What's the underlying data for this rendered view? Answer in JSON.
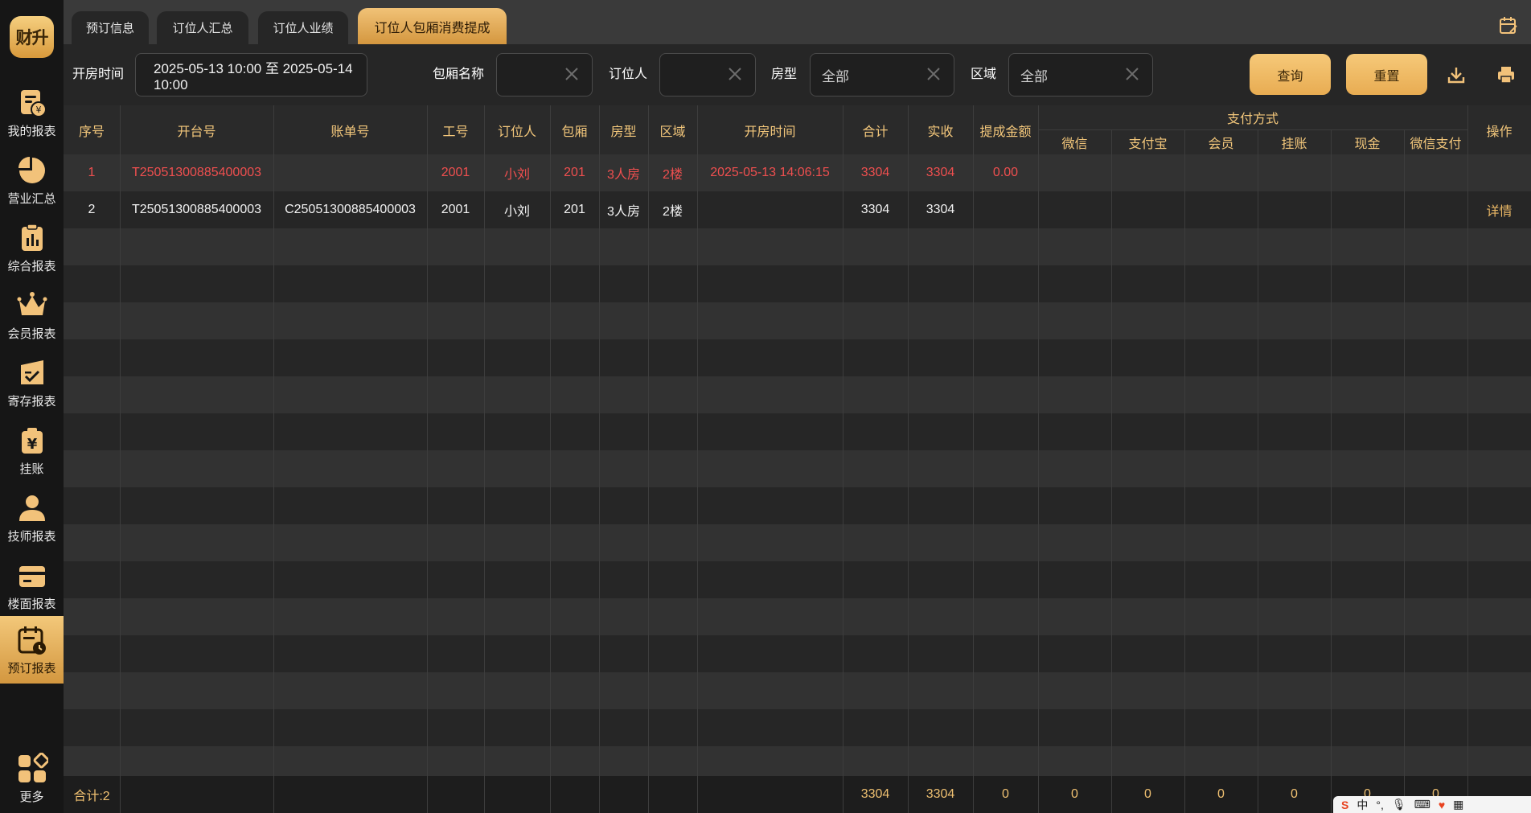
{
  "sidebar": {
    "logo_text": "财升",
    "items": [
      {
        "label": "我的报表",
        "icon": "report-money-icon"
      },
      {
        "label": "营业汇总",
        "icon": "pie-chart-icon"
      },
      {
        "label": "综合报表",
        "icon": "clipboard-chart-icon"
      },
      {
        "label": "会员报表",
        "icon": "crown-icon"
      },
      {
        "label": "寄存报表",
        "icon": "storage-check-icon"
      },
      {
        "label": "挂账",
        "icon": "bag-yuan-icon"
      },
      {
        "label": "技师报表",
        "icon": "person-icon"
      },
      {
        "label": "楼面报表",
        "icon": "card-icon"
      },
      {
        "label": "预订报表",
        "icon": "calendar-clock-icon"
      },
      {
        "label": "更多",
        "icon": "more-apps-icon"
      }
    ],
    "active_index": 8
  },
  "tabs": [
    {
      "label": "预订信息"
    },
    {
      "label": "订位人汇总"
    },
    {
      "label": "订位人业绩"
    },
    {
      "label": "订位人包厢消费提成"
    }
  ],
  "filters": {
    "open_time_label": "开房时间",
    "open_time_value": "2025-05-13 10:00 至 2025-05-14 10:00",
    "room_name_label": "包厢名称",
    "room_name_value": "",
    "booker_label": "订位人",
    "booker_value": "",
    "room_type_label": "房型",
    "room_type_value": "全部",
    "area_label": "区域",
    "area_value": "全部",
    "query_label": "查询",
    "reset_label": "重置"
  },
  "table": {
    "headers": {
      "seq": "序号",
      "open_no": "开台号",
      "bill_no": "账单号",
      "emp_no": "工号",
      "booker": "订位人",
      "room": "包厢",
      "room_type": "房型",
      "area": "区域",
      "open_time": "开房时间",
      "total": "合计",
      "paid": "实收",
      "commission": "提成金额",
      "pay_group": "支付方式",
      "wechat": "微信",
      "alipay": "支付宝",
      "member": "会员",
      "credit": "挂账",
      "cash": "现金",
      "wechat_pay": "微信支付",
      "action": "操作"
    },
    "rows": [
      {
        "seq": "1",
        "open_no": "T25051300885400003",
        "bill_no": "",
        "emp_no": "2001",
        "booker": "小刘",
        "room": "201",
        "room_type": "3人房",
        "area": "2楼",
        "open_time": "2025-05-13 14:06:15",
        "total": "3304",
        "paid": "3304",
        "commission": "0.00",
        "action": ""
      },
      {
        "seq": "2",
        "open_no": "T25051300885400003",
        "bill_no": "C25051300885400003",
        "emp_no": "2001",
        "booker": "小刘",
        "room": "201",
        "room_type": "3人房",
        "area": "2楼",
        "open_time": "",
        "total": "3304",
        "paid": "3304",
        "commission": "",
        "action": "详情"
      }
    ],
    "footer": {
      "label": "合计:2",
      "total": "3304",
      "paid": "3304",
      "commission": "0",
      "wechat": "0",
      "alipay": "0",
      "member": "0",
      "credit": "0",
      "cash": "0",
      "wechat_pay": "0"
    }
  },
  "ime": {
    "lang": "中",
    "punct": "°,"
  },
  "colors": {
    "accent": "#f1c277",
    "header_text": "#f3c77b",
    "highlight_row_text": "#ef4f4f",
    "background": "#242424"
  }
}
